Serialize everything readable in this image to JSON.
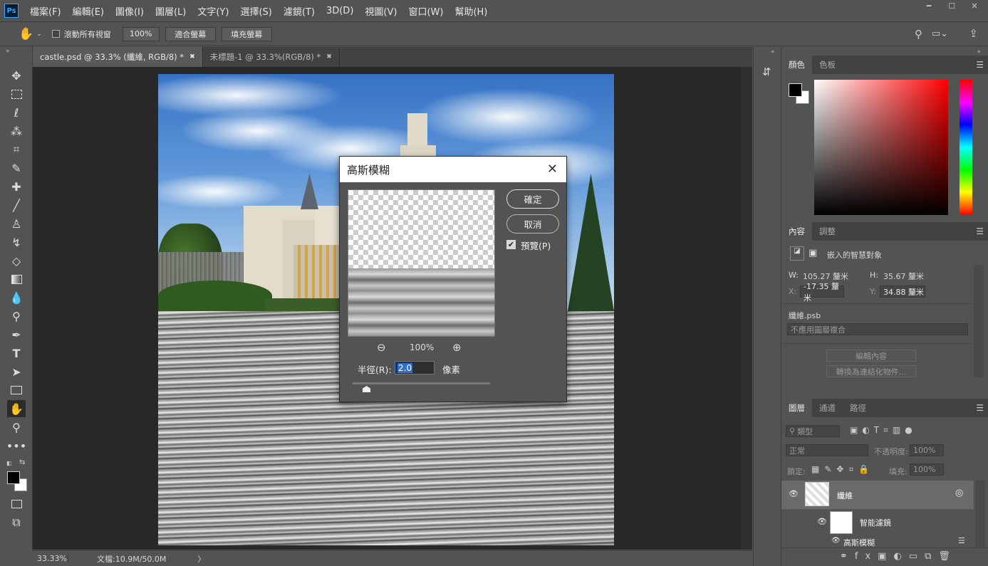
{
  "app": {
    "logo": "Ps"
  },
  "menu": [
    "檔案(F)",
    "編輯(E)",
    "圖像(I)",
    "圖層(L)",
    "文字(Y)",
    "選擇(S)",
    "濾鏡(T)",
    "3D(D)",
    "視圖(V)",
    "窗口(W)",
    "幫助(H)"
  ],
  "options": {
    "scroll_all_label": "滾動所有視窗",
    "zoom_btn": "100%",
    "fit_screen_btn": "適合螢幕",
    "fill_screen_btn": "填充螢幕"
  },
  "tabs": [
    {
      "label": "castle.psd @ 33.3% (纖維, RGB/8) *",
      "close": "✖"
    },
    {
      "label": "未標題-1 @ 33.3%(RGB/8) *",
      "close": "✖"
    }
  ],
  "status": {
    "zoom": "33.33%",
    "doc": "文檔:10.9M/50.0M",
    "arrow": "〉"
  },
  "dialog": {
    "title": "高斯模糊",
    "ok": "確定",
    "cancel": "取消",
    "preview_label": "預覽(P)",
    "zoom": "100%",
    "radius_label": "半徑(R):",
    "radius_value": "2.0",
    "unit": "像素"
  },
  "color_panel": {
    "tabs": [
      "顏色",
      "色板"
    ]
  },
  "properties_panel": {
    "tabs": [
      "內容",
      "調整"
    ],
    "object_type": "嵌入的智慧對象",
    "w_label": "W:",
    "w_value": "105.27 釐米",
    "h_label": "H:",
    "h_value": "35.67 釐米",
    "x_label": "X:",
    "x_value": "-17.35 釐米",
    "y_label": "Y:",
    "y_value": "34.88 釐米",
    "file_name": "纖維.psb",
    "comp_placeholder": "不應用圖層複合",
    "edit_btn": "編輯內容",
    "convert_btn": "轉換為連結化物件..."
  },
  "layers_panel": {
    "tabs": [
      "圖層",
      "通道",
      "路徑"
    ],
    "filter_kind": "類型",
    "blend_mode": "正常",
    "opacity_label": "不透明度:",
    "opacity_value": "100%",
    "lock_label": "鎖定:",
    "fill_label": "填充:",
    "fill_value": "100%",
    "layers": [
      {
        "name": "纖維"
      },
      {
        "name": "智能濾鏡"
      },
      {
        "name": "高斯模糊"
      }
    ]
  }
}
